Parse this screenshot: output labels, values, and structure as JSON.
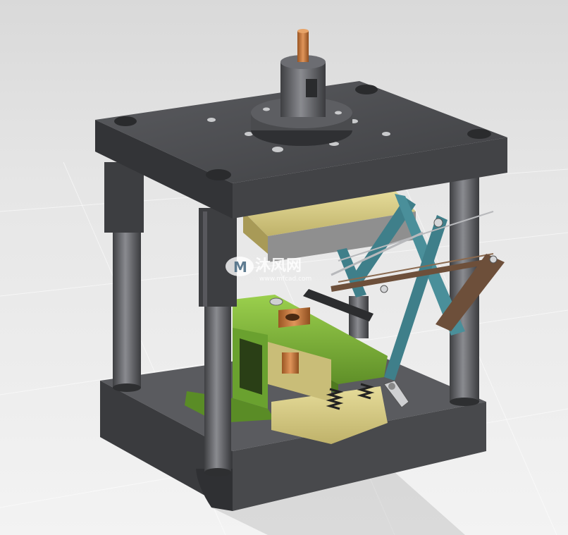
{
  "scene": {
    "subject": "die-set",
    "colors": {
      "background": "#e3e3e3",
      "plate_dark": "#4a4b4e",
      "pillar": "#6a6b70",
      "yellow_block": "#d9cd86",
      "green_part": "#7fb83a",
      "teal_link": "#3f7f8a",
      "copper": "#c7793f",
      "steel": "#b8b9bc"
    }
  },
  "watermark": {
    "brand": "沐风网",
    "url": "www.mfcad.com"
  }
}
